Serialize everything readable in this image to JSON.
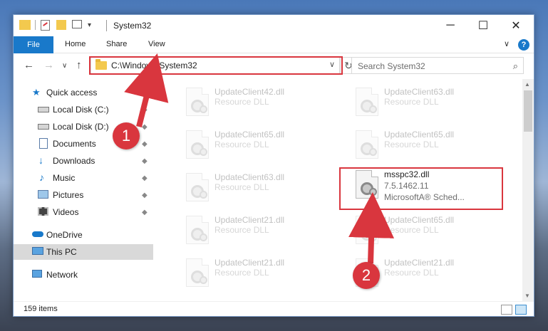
{
  "window": {
    "title": "System32",
    "minimize": "─",
    "maximize": "☐",
    "close": "✕"
  },
  "ribbon": {
    "tabs": [
      "File",
      "Home",
      "Share",
      "View"
    ],
    "expand": "∨",
    "help": "?"
  },
  "address": {
    "path": "C:\\Windows\\System32",
    "back": "←",
    "forward": "→",
    "recent": "∨",
    "up": "↑",
    "dropdown": "∨",
    "refresh": "↻"
  },
  "search": {
    "placeholder": "Search System32",
    "icon": "⌕"
  },
  "navigation": {
    "quick_access": "Quick access",
    "pinned": [
      {
        "label": "Local Disk (C:)",
        "icon": "drive-icon"
      },
      {
        "label": "Local Disk (D:)",
        "icon": "drive-icon"
      },
      {
        "label": "Documents",
        "icon": "documents-icon"
      },
      {
        "label": "Downloads",
        "icon": "downloads-icon"
      },
      {
        "label": "Music",
        "icon": "music-icon"
      },
      {
        "label": "Pictures",
        "icon": "pictures-icon"
      },
      {
        "label": "Videos",
        "icon": "videos-icon"
      }
    ],
    "onedrive": "OneDrive",
    "this_pc": "This PC",
    "network": "Network",
    "pin_glyph": "📌"
  },
  "files": {
    "left_column": [
      {
        "name": "UpdateClient42.dll",
        "sub1": "Resource DLL"
      },
      {
        "name": "UpdateClient65.dll",
        "sub1": "Resource DLL"
      },
      {
        "name": "UpdateClient63.dll",
        "sub1": "Resource DLL"
      },
      {
        "name": "UpdateClient21.dll",
        "sub1": "Resource DLL"
      },
      {
        "name": "UpdateClient21.dll",
        "sub1": "Resource DLL"
      }
    ],
    "right_column": [
      {
        "name": "UpdateClient63.dll",
        "sub1": "Resource DLL"
      },
      {
        "name": "UpdateClient65.dll",
        "sub1": "Resource DLL"
      },
      {
        "name": "UpdateClient65.dll",
        "sub1": "Resource DLL"
      },
      {
        "name": "UpdateClient21.dll",
        "sub1": "Resource DLL"
      }
    ],
    "highlighted": {
      "name": "msspc32.dll",
      "version": "7.5.1462.11",
      "company": "MicrosoftA® Sched..."
    }
  },
  "status": {
    "count": "159 items"
  },
  "annotations": {
    "callout_1": "1",
    "callout_2": "2",
    "color": "#d9363e"
  },
  "colors": {
    "accent": "#1979ca",
    "highlight": "#d9363e",
    "selected_nav": "#d9d9d9"
  }
}
